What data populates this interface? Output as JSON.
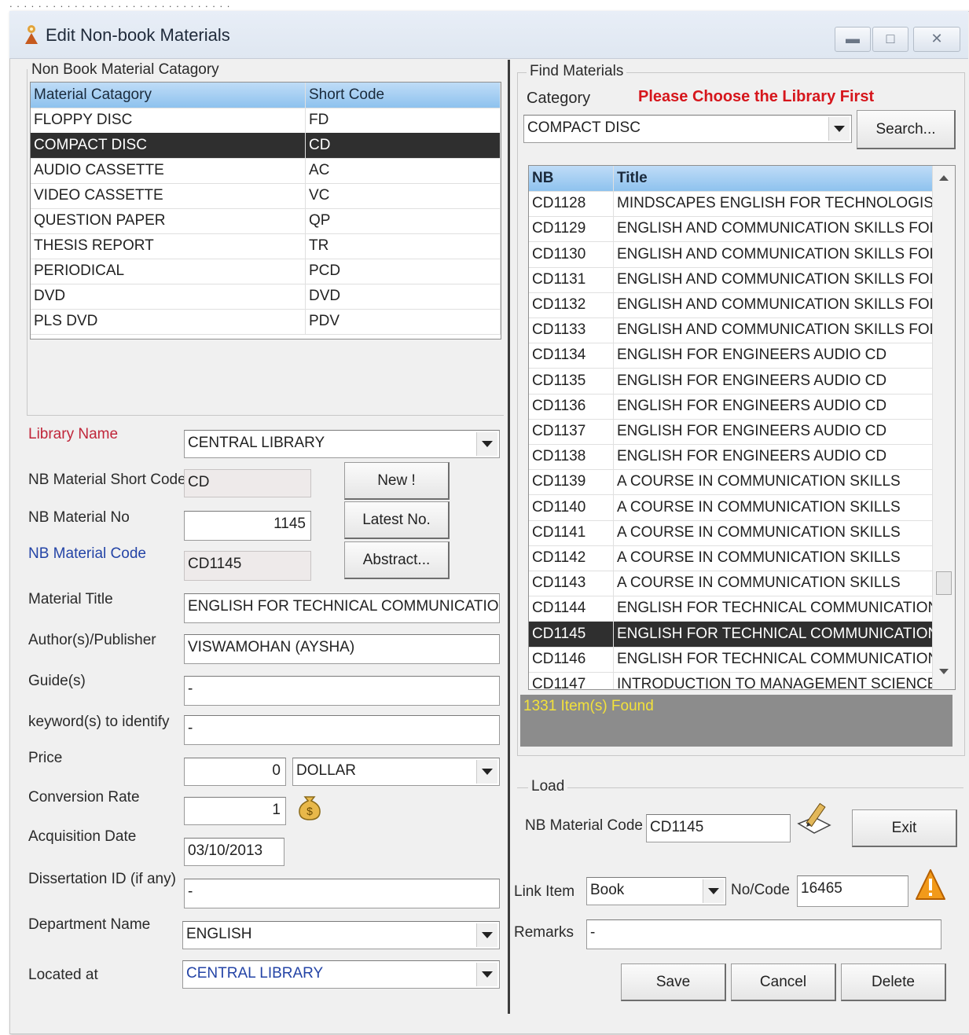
{
  "window": {
    "title": "Edit Non-book Materials"
  },
  "category_panel": {
    "legend": "Non Book Material Catagory",
    "headers": [
      "Material Catagory",
      "Short Code"
    ],
    "rows": [
      [
        "FLOPPY DISC",
        "FD"
      ],
      [
        "COMPACT DISC",
        "CD"
      ],
      [
        "AUDIO CASSETTE",
        "AC"
      ],
      [
        "VIDEO CASSETTE",
        "VC"
      ],
      [
        "QUESTION PAPER",
        "QP"
      ],
      [
        "THESIS REPORT",
        "TR"
      ],
      [
        "PERIODICAL",
        "PCD"
      ],
      [
        "DVD",
        "DVD"
      ],
      [
        "PLS DVD",
        "PDV"
      ]
    ],
    "selected": "COMPACT DISC"
  },
  "form": {
    "library_name_label": "Library Name",
    "library_name_value": "CENTRAL LIBRARY",
    "short_code_label": "NB Material Short Code",
    "short_code_value": "CD",
    "material_no_label": "NB Material No",
    "material_no_value": "1145",
    "material_code_label": "NB Material Code",
    "material_code_value": "CD1145",
    "title_label": "Material Title",
    "title_value": "ENGLISH FOR TECHNICAL COMMUNICATION",
    "author_label": "Author(s)/Publisher",
    "author_value": "VISWAMOHAN (AYSHA)",
    "guide_label": "Guide(s)",
    "guide_value": "-",
    "keyword_label": "keyword(s) to identify",
    "keyword_value": "-",
    "price_label": "Price",
    "price_value": "0",
    "currency_value": "DOLLAR",
    "conversion_label": "Conversion Rate",
    "conversion_value": "1",
    "acq_date_label": "Acquisition Date",
    "acq_date_value": "03/10/2013",
    "dissertation_label": "Dissertation ID (if any)",
    "dissertation_value": "-",
    "department_label": "Department Name",
    "department_value": "ENGLISH",
    "located_label": "Located at",
    "located_value": "CENTRAL LIBRARY",
    "buttons": {
      "new": "New !",
      "latest": "Latest No.",
      "abstract": "Abstract..."
    }
  },
  "find": {
    "legend": "Find Materials",
    "category_label": "Category",
    "warning": "Please Choose the Library First",
    "category_value": "COMPACT DISC",
    "search_button": "Search...",
    "headers": [
      "NB",
      "Title"
    ],
    "rows": [
      [
        "CD1128",
        "MINDSCAPES ENGLISH FOR TECHNOLOGISTS"
      ],
      [
        "CD1129",
        "ENGLISH AND COMMUNICATION SKILLS FOR"
      ],
      [
        "CD1130",
        "ENGLISH AND COMMUNICATION SKILLS FOR"
      ],
      [
        "CD1131",
        "ENGLISH AND COMMUNICATION SKILLS FOR"
      ],
      [
        "CD1132",
        "ENGLISH AND COMMUNICATION SKILLS FOR"
      ],
      [
        "CD1133",
        "ENGLISH AND COMMUNICATION SKILLS FOR"
      ],
      [
        "CD1134",
        "ENGLISH FOR ENGINEERS AUDIO CD"
      ],
      [
        "CD1135",
        "ENGLISH FOR ENGINEERS AUDIO CD"
      ],
      [
        "CD1136",
        "ENGLISH FOR ENGINEERS AUDIO CD"
      ],
      [
        "CD1137",
        "ENGLISH FOR ENGINEERS AUDIO CD"
      ],
      [
        "CD1138",
        "ENGLISH FOR ENGINEERS AUDIO CD"
      ],
      [
        "CD1139",
        "A COURSE IN COMMUNICATION SKILLS"
      ],
      [
        "CD1140",
        "A COURSE IN COMMUNICATION SKILLS"
      ],
      [
        "CD1141",
        "A COURSE IN COMMUNICATION SKILLS"
      ],
      [
        "CD1142",
        "A COURSE IN COMMUNICATION SKILLS"
      ],
      [
        "CD1143",
        "A COURSE IN COMMUNICATION SKILLS"
      ],
      [
        "CD1144",
        "ENGLISH FOR TECHNICAL COMMUNICATION"
      ],
      [
        "CD1145",
        "ENGLISH FOR TECHNICAL COMMUNICATION"
      ],
      [
        "CD1146",
        "ENGLISH FOR TECHNICAL COMMUNICATION"
      ],
      [
        "CD1147",
        "INTRODUCTION TO MANAGEMENT SCIENCE"
      ]
    ],
    "selected": "CD1145",
    "status": "1331 Item(s) Found"
  },
  "load": {
    "legend": "Load",
    "code_label": "NB Material Code",
    "code_value": "CD1145",
    "exit_button": "Exit"
  },
  "link": {
    "link_label": "Link Item",
    "link_value": "Book",
    "nocode_label": "No/Code",
    "nocode_value": "16465",
    "remarks_label": "Remarks",
    "remarks_value": "-"
  },
  "actions": {
    "save": "Save",
    "cancel": "Cancel",
    "delete": "Delete"
  },
  "colors": {
    "warning": "#d6161c",
    "label_red": "#c0263a",
    "label_blue": "#2444a6",
    "header": "#8ec2ee",
    "selected": "#2f2f2f",
    "status_text": "#f3e23a"
  }
}
